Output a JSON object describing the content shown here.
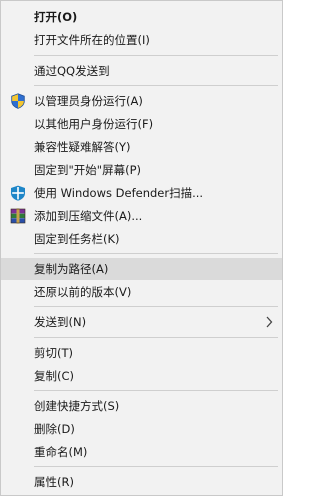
{
  "menu": {
    "items": [
      {
        "label": "打开(O)"
      },
      {
        "label": "打开文件所在的位置(I)"
      },
      {
        "label": "通过QQ发送到"
      },
      {
        "label": "以管理员身份运行(A)",
        "icon": "uac-shield-icon"
      },
      {
        "label": "以其他用户身份运行(F)"
      },
      {
        "label": "兼容性疑难解答(Y)"
      },
      {
        "label": "固定到\"开始\"屏幕(P)"
      },
      {
        "label": "使用 Windows Defender扫描...",
        "icon": "windows-defender-icon"
      },
      {
        "label": "添加到压缩文件(A)...",
        "icon": "winrar-archive-icon"
      },
      {
        "label": "固定到任务栏(K)"
      },
      {
        "label": "复制为路径(A)"
      },
      {
        "label": "还原以前的版本(V)"
      },
      {
        "label": "发送到(N)",
        "icon": "chevron-right-icon"
      },
      {
        "label": "剪切(T)"
      },
      {
        "label": "复制(C)"
      },
      {
        "label": "创建快捷方式(S)"
      },
      {
        "label": "删除(D)"
      },
      {
        "label": "重命名(M)"
      },
      {
        "label": "属性(R)"
      }
    ]
  },
  "colors": {
    "menu_background": "#f2f2f2",
    "hover_background": "#dadada",
    "separator": "#cfcfcf",
    "text": "#1a1a1a"
  }
}
